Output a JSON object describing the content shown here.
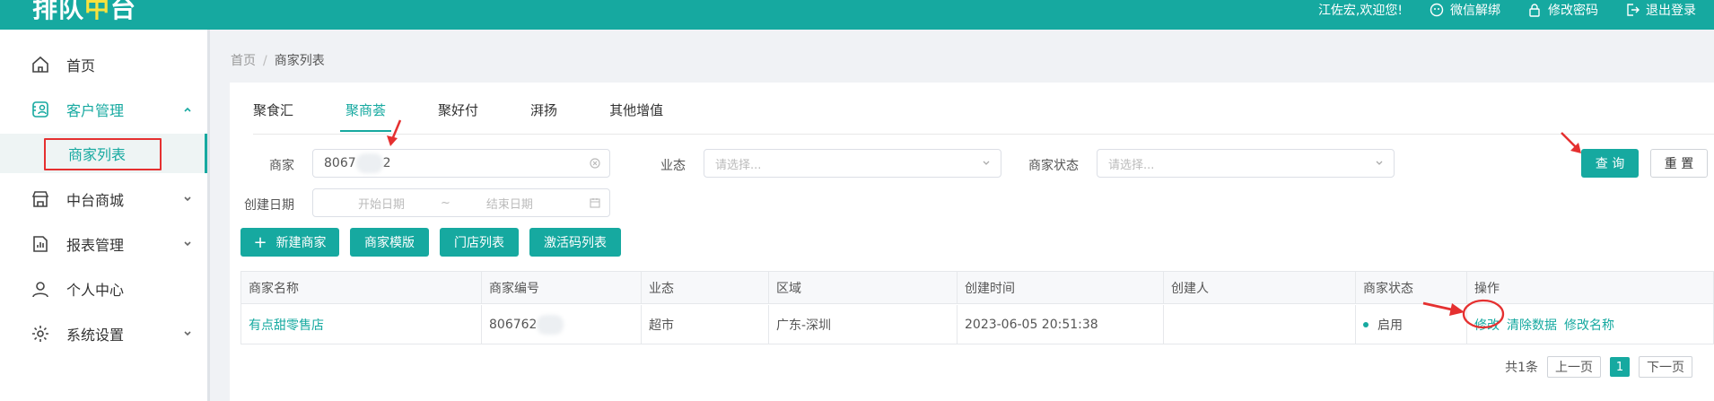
{
  "app": {
    "logo_main": "排队",
    "logo_accent": "中",
    "logo_tail": "台"
  },
  "header": {
    "welcome": "江佐宏,欢迎您!",
    "wechat_unbind": "微信解绑",
    "change_password": "修改密码",
    "logout": "退出登录"
  },
  "sidebar": {
    "home": "首页",
    "customer_mgmt": "客户管理",
    "merchant_list": "商家列表",
    "mall": "中台商城",
    "reports": "报表管理",
    "personal": "个人中心",
    "settings": "系统设置"
  },
  "breadcrumb": {
    "root": "首页",
    "sep": "/",
    "current": "商家列表"
  },
  "tabs": [
    "聚食汇",
    "聚商荟",
    "聚好付",
    "湃扬",
    "其他增值"
  ],
  "filters": {
    "merchant_label": "商家",
    "merchant_value_a": "8067",
    "merchant_value_b": "2",
    "business_label": "业态",
    "business_placeholder": "请选择...",
    "status_label": "商家状态",
    "status_placeholder": "请选择...",
    "date_label": "创建日期",
    "date_start": "开始日期",
    "date_sep": "~",
    "date_end": "结束日期"
  },
  "buttons": {
    "query": "查 询",
    "reset": "重 置",
    "new_merchant": "新建商家",
    "merchant_template": "商家模版",
    "store_list": "门店列表",
    "activation_codes": "激活码列表"
  },
  "table": {
    "headers": [
      "商家名称",
      "商家编号",
      "业态",
      "区域",
      "创建时间",
      "创建人",
      "商家状态",
      "操作"
    ],
    "row": {
      "name": "有点甜零售店",
      "code": "806762",
      "business": "超市",
      "region": "广东-深圳",
      "created": "2023-06-05 20:51:38",
      "creator": "",
      "status": "启用",
      "actions": [
        "修改",
        "清除数据",
        "修改名称"
      ]
    }
  },
  "pager": {
    "total": "共1条",
    "prev": "上一页",
    "current": "1",
    "next": "下一页"
  },
  "colors": {
    "brand": "#16a9a0",
    "annotation": "#e53030",
    "logo_accent": "#f7e23e"
  }
}
